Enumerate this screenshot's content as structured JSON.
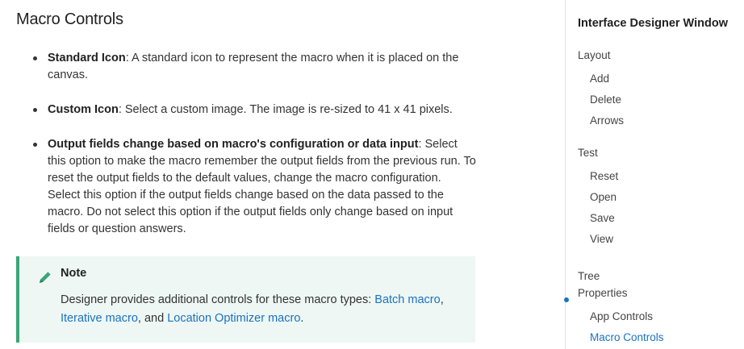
{
  "page_title": "Macro Controls",
  "bullets": [
    {
      "term": "Standard Icon",
      "text": ": A standard icon to represent the macro when it is placed on the canvas."
    },
    {
      "term": "Custom Icon",
      "text": ": Select a custom image. The image is re-sized to 41 x 41 pixels."
    },
    {
      "term": "Output fields change based on macro's configuration or data input",
      "text": ": Select this option to make the macro remember the output fields from the previous run. To reset the output fields to the default values, change the macro configuration. Select this option if the output fields change based on the data passed to the macro. Do not select this option if the output fields only change based on input fields or question answers."
    }
  ],
  "note": {
    "icon": "pencil-icon",
    "title": "Note",
    "text_before": "Designer provides additional controls for these macro types: ",
    "link_batch": "Batch macro",
    "sep1": ",",
    "link_iterative": "Iterative macro",
    "sep2": ", and ",
    "link_location": "Location Optimizer macro",
    "text_after": ".",
    "accent_color": "#3aa678",
    "background_color": "#eef7f3",
    "link_color": "#1a72c2"
  },
  "sidebar": {
    "title": "Interface Designer Window",
    "sections": [
      {
        "label": "Layout",
        "items": [
          "Add",
          "Delete",
          "Arrows"
        ]
      },
      {
        "label": "Test",
        "items": [
          "Reset",
          "Open",
          "Save",
          "View"
        ]
      },
      {
        "label": "Tree Properties",
        "items": [
          "App Controls",
          "Macro Controls"
        ]
      }
    ],
    "tree_line1": "Tree",
    "tree_line2": "Properties",
    "active_item": "Macro Controls",
    "active_color": "#1a72c2"
  }
}
